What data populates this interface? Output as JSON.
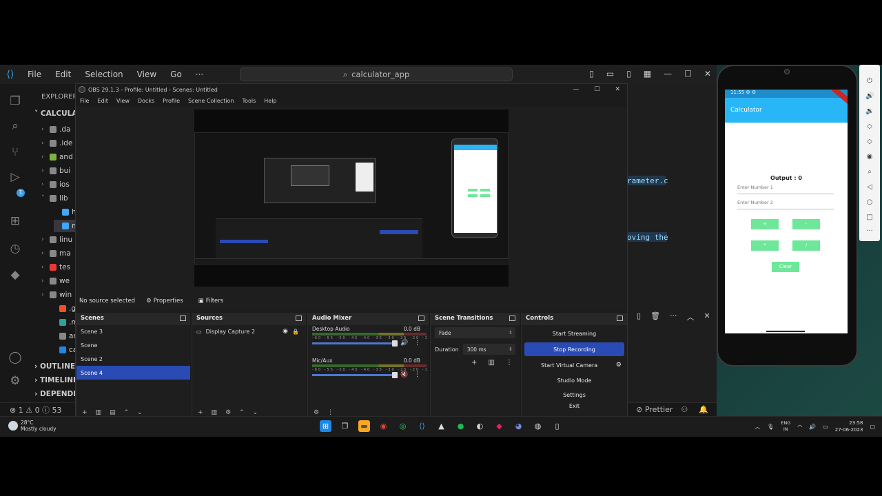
{
  "vscode": {
    "menu": [
      "File",
      "Edit",
      "Selection",
      "View",
      "Go",
      "···"
    ],
    "search_text": "calculator_app",
    "explorer_header": "EXPLORER",
    "project_name": "CALCULAT",
    "tree": [
      ".da",
      ".ide",
      "and",
      "bui",
      "ios",
      "lib",
      "h",
      "m",
      "linu",
      "ma",
      "tes",
      "we",
      "win",
      ".git",
      ".me",
      "ana",
      "cal"
    ],
    "sections": [
      "OUTLINE",
      "TIMELINE",
      "DEPENDE"
    ],
    "status_left": "⊗ 1 ⚠ 0 ⓘ 53",
    "status_prettier": "Prettier",
    "code_fragments": [
      "rameter.c",
      "oving the"
    ],
    "badge_count": "1"
  },
  "obs": {
    "title": "OBS 29.1.3 - Profile: Untitled - Scenes: Untitled",
    "menu": [
      "File",
      "Edit",
      "View",
      "Docks",
      "Profile",
      "Scene Collection",
      "Tools",
      "Help"
    ],
    "no_source": "No source selected",
    "properties_label": "Properties",
    "filters_label": "Filters",
    "scenes": {
      "header": "Scenes",
      "items": [
        "Scene 3",
        "Scene",
        "Scene 2",
        "Scene 4"
      ],
      "selected_index": 3
    },
    "sources": {
      "header": "Sources",
      "items": [
        "Display Capture 2"
      ]
    },
    "mixer": {
      "header": "Audio Mixer",
      "channels": [
        {
          "name": "Desktop Audio",
          "db": "0.0 dB",
          "level": 0.72
        },
        {
          "name": "Mic/Aux",
          "db": "0.0 dB",
          "level": 0.72
        }
      ],
      "tick_labels": "-60 -55 -50 -45 -40 -35 -30 -25 -20 -15 -10 -5 0"
    },
    "transitions": {
      "header": "Scene Transitions",
      "type": "Fade",
      "duration_label": "Duration",
      "duration_value": "300 ms"
    },
    "controls": {
      "header": "Controls",
      "buttons": [
        "Start Streaming",
        "Stop Recording",
        "Start Virtual Camera",
        "Studio Mode",
        "Settings",
        "Exit"
      ],
      "active_index": 1
    }
  },
  "emulator": {
    "status_time": "11:55 ⚙ ⚙",
    "app_title": "Calculator",
    "output": "Output : 0",
    "input1_placeholder": "Enter Number 1",
    "input2_placeholder": "Enter Number 2",
    "buttons": [
      "+",
      "-",
      "*",
      "/"
    ],
    "clear": "Clear"
  },
  "taskbar": {
    "temp": "28°C",
    "weather": "Mostly cloudy",
    "lang1": "ENG",
    "lang2": "IN",
    "time": "23:58",
    "date": "27-06-2023"
  },
  "colors": {
    "obs_accent": "#2a4bb4",
    "vscode_blue": "#3a9ee8",
    "emu_appbar": "#29b6f6",
    "calc_button": "#6ee79a"
  }
}
